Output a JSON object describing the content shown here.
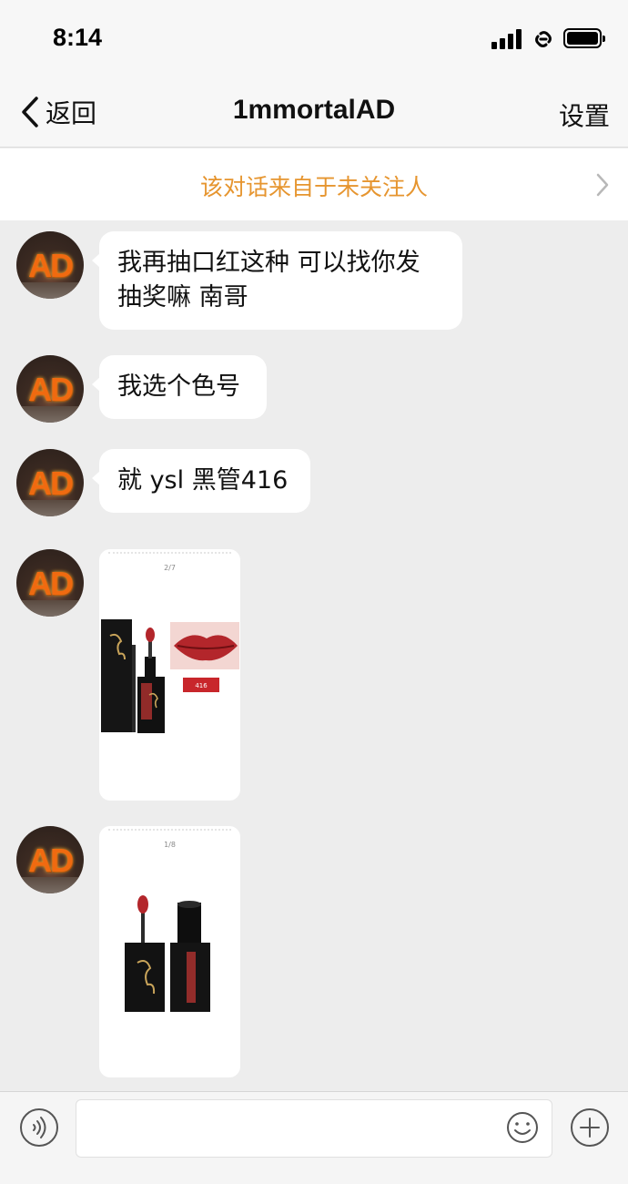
{
  "status_bar": {
    "time": "8:14"
  },
  "nav": {
    "back_label": "返回",
    "title": "1mmortalAD",
    "settings_label": "设置"
  },
  "notice": {
    "text": "该对话来自于未关注人"
  },
  "messages": [
    {
      "type": "text",
      "lines": [
        "我再抽口红这种 可以找你发",
        "抽奖嘛 南哥"
      ]
    },
    {
      "type": "text",
      "lines": [
        "我选个色号"
      ]
    },
    {
      "type": "text",
      "lines": [
        "就 ysl 黑管416"
      ]
    },
    {
      "type": "image",
      "page_label": "2/7",
      "shade_tag": "416"
    },
    {
      "type": "image",
      "page_label": "1/8"
    }
  ],
  "avatar": {
    "text": "AD"
  },
  "input": {
    "value": "",
    "placeholder": ""
  },
  "colors": {
    "notice_text": "#e6952f",
    "background": "#ededed",
    "bubble": "#ffffff",
    "lipstick_red": "#b3262b"
  }
}
